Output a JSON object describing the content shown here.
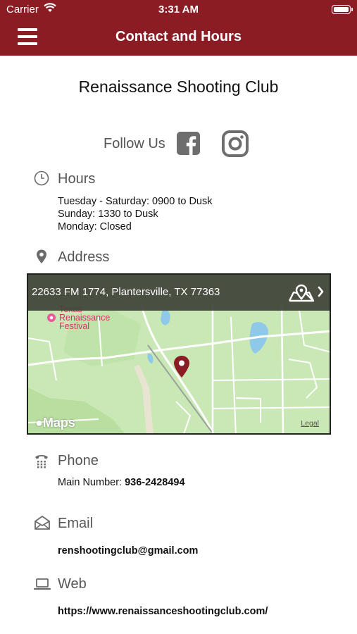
{
  "status_bar": {
    "carrier": "Carrier",
    "time": "3:31 AM"
  },
  "nav": {
    "title": "Contact and Hours"
  },
  "club": {
    "name": "Renaissance Shooting Club"
  },
  "follow": {
    "label": "Follow Us",
    "icons": [
      "facebook-icon",
      "instagram-icon"
    ]
  },
  "hours": {
    "title": "Hours",
    "lines": [
      "Tuesday - Saturday: 0900 to Dusk",
      "Sunday: 1330 to Dusk",
      "Monday: Closed"
    ]
  },
  "address": {
    "title": "Address",
    "map_address": "22633 FM 1774, Plantersville, TX 77363",
    "poi_line1": "Texas",
    "poi_line2": "Renaissance",
    "poi_line3": "Festival",
    "maps_label": "Maps",
    "legal": "Legal"
  },
  "phone": {
    "title": "Phone",
    "label": "Main Number:",
    "number": "936-2428494"
  },
  "email": {
    "title": "Email",
    "value": "renshootingclub@gmail.com"
  },
  "web": {
    "title": "Web",
    "value": "https://www.renaissanceshootingclub.com/"
  },
  "colors": {
    "header": "#8c1c24",
    "map_land": "#c9e8b6",
    "pin": "#8c1c24"
  }
}
